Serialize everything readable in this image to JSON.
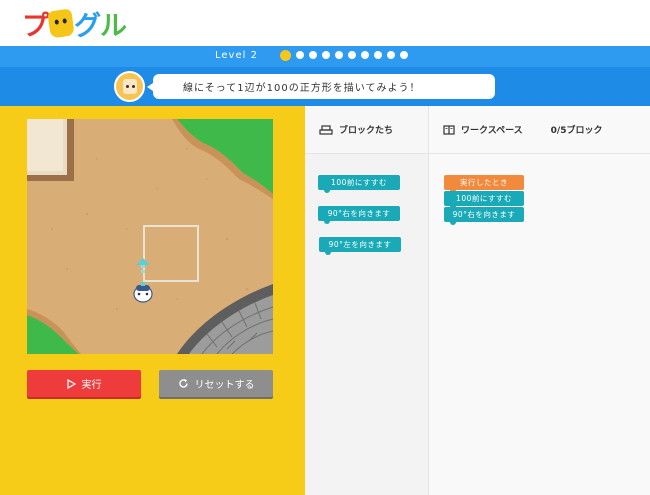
{
  "app": {
    "logo": {
      "char1": "プ",
      "char2": "グ",
      "char3": "ル",
      "colors": [
        "#e8352f",
        "#f5c518",
        "#2a9ff0",
        "#4cbb47"
      ]
    }
  },
  "level": {
    "label": "Level 2",
    "total": 10,
    "current": 1
  },
  "instruction": {
    "text": "線にそって1辺が100の正方形を描いてみよう！"
  },
  "controls": {
    "run_label": "実行",
    "reset_label": "リセットする"
  },
  "blocks_panel": {
    "title": "ブロックたち",
    "blocks": [
      {
        "label": "100前にすすむ",
        "color": "#19a9b7"
      },
      {
        "label": "90°右を向きます",
        "color": "#19a9b7"
      },
      {
        "label": "90°左を向きます",
        "color": "#19a9b7"
      }
    ]
  },
  "workspace": {
    "title": "ワークスペース",
    "count": "0/5ブロック",
    "blocks": [
      {
        "label": "実行したとき",
        "color": "#f28a3e"
      },
      {
        "label": "100前にすすむ",
        "color": "#19a9b7"
      },
      {
        "label": "90°右を向きます",
        "color": "#19a9b7"
      }
    ]
  },
  "colors": {
    "header_blue": "#2e9af0",
    "instruction_blue": "#1e8be6",
    "stage_yellow": "#f6cc19",
    "run_red": "#ee3c3c",
    "reset_gray": "#8e8e8e",
    "block_teal": "#19a9b7",
    "block_orange": "#f28a3e"
  }
}
